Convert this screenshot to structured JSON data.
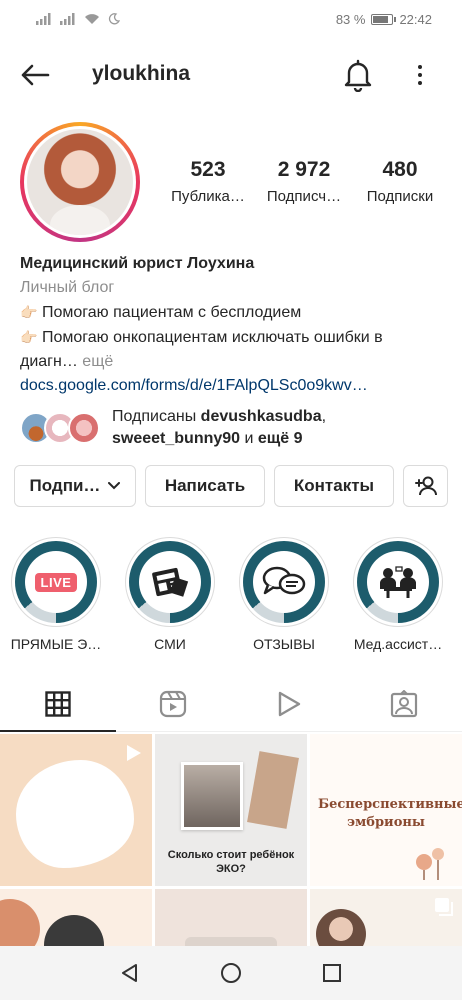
{
  "status_bar": {
    "battery": "83 %",
    "battery_level": 0.83,
    "time": "22:42"
  },
  "header": {
    "username": "yloukhina"
  },
  "profile": {
    "stats": [
      {
        "value": "523",
        "label": "Публика…"
      },
      {
        "value": "2 972",
        "label": "Подписч…"
      },
      {
        "value": "480",
        "label": "Подписки"
      }
    ],
    "name": "Медицинский юрист Лоухина",
    "category": "Личный блог",
    "bio_line1": "Помогаю пациентам с бесплодием",
    "bio_line2": "Помогаю онкопациентам исключать ошибки в",
    "bio_line3": "диагн…",
    "more": "ещё",
    "link": "docs.google.com/forms/d/e/1FAlpQLSc0o9kwv…"
  },
  "followed_by": {
    "prefix": "Подписаны",
    "user1": "devushkasudba",
    "user2": "sweeet_bunny90",
    "conj": "и",
    "rest": "ещё 9"
  },
  "buttons": {
    "subscribed": "Подпи…",
    "message": "Написать",
    "contacts": "Контакты"
  },
  "highlights": [
    {
      "label": "ПРЯМЫЕ Э…",
      "icon": "live-badge",
      "badge_text": "LIVE"
    },
    {
      "label": "СМИ",
      "icon": "newspaper-icon"
    },
    {
      "label": "ОТЗЫВЫ",
      "icon": "chat-bubbles-icon"
    },
    {
      "label": "Мед.ассист…",
      "icon": "meeting-icon"
    }
  ],
  "tabs": [
    "grid-icon",
    "reels-icon",
    "video-icon",
    "tagged-icon"
  ],
  "grid": {
    "post2_caption": "Сколько стоит ребёнок ЭКО?",
    "post3_caption": "Бесперспективные эмбрионы"
  },
  "colors": {
    "highlight_teal": "#1d5c6c",
    "link": "#00376b",
    "live_red": "#ef5f6d",
    "story_ring": "#e8365f"
  }
}
